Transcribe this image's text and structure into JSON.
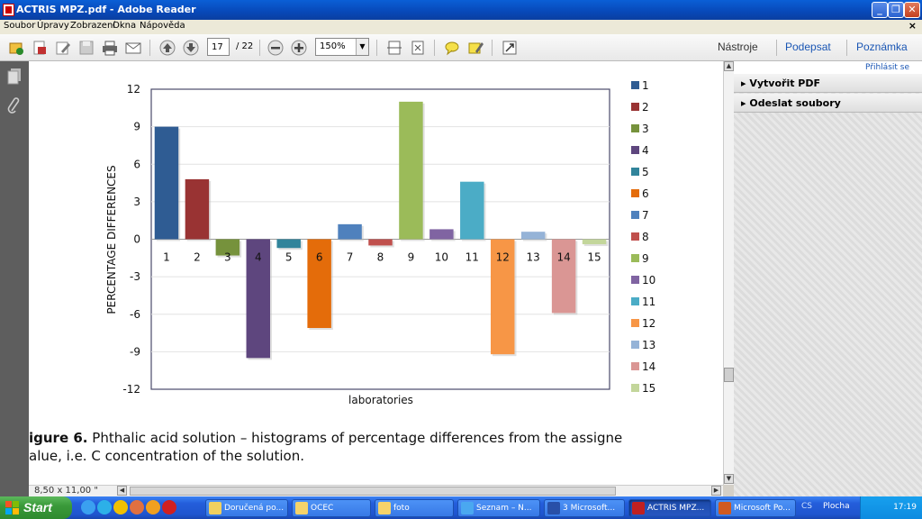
{
  "window": {
    "title": "ACTRIS MPZ.pdf - Adobe Reader"
  },
  "menu": [
    "Soubor",
    "Úpravy",
    "Zobrazení",
    "Okna",
    "Nápověda"
  ],
  "toolbar": {
    "page_current": "17",
    "page_total": "/ 22",
    "zoom": "150%",
    "links": [
      "Nástroje",
      "Podepsat",
      "Poznámka"
    ]
  },
  "right_pane": {
    "sign_in": "Přihlásit se",
    "items": [
      "Vytvořit PDF",
      "Odeslat soubory"
    ]
  },
  "document": {
    "caption_bold": "igure 6.",
    "caption_text": " Phthalic acid solution – histograms of percentage differences from the assigne",
    "caption_line2": "alue, i.e. C concentration of the solution."
  },
  "status": {
    "page_size": "8,50 x 11,00 \""
  },
  "chart_data": {
    "type": "bar",
    "categories": [
      "1",
      "2",
      "3",
      "4",
      "5",
      "6",
      "7",
      "8",
      "9",
      "10",
      "11",
      "12",
      "13",
      "14",
      "15"
    ],
    "values": [
      9.0,
      4.8,
      -1.3,
      -9.5,
      -0.7,
      -7.1,
      1.2,
      -0.5,
      11.0,
      0.8,
      4.6,
      -9.2,
      0.6,
      -5.9,
      -0.4
    ],
    "colors": [
      "#2f5c93",
      "#993333",
      "#76923c",
      "#5e467e",
      "#31849b",
      "#e46c0a",
      "#4f81bd",
      "#c0504d",
      "#9bbb59",
      "#8064a2",
      "#4bacc6",
      "#f79646",
      "#95b3d7",
      "#da9694",
      "#c3d69b"
    ],
    "legend": [
      "1",
      "2",
      "3",
      "4",
      "5",
      "6",
      "7",
      "8",
      "9",
      "10",
      "11",
      "12",
      "13",
      "14",
      "15"
    ],
    "ylabel": "PERCENTAGE DIFFERENCES",
    "xlabel": "laboratories",
    "yticks": [
      "12",
      "9",
      "6",
      "3",
      "0",
      "-3",
      "-6",
      "-9",
      "-12"
    ],
    "ylim": [
      -12,
      12
    ],
    "legend_position": "right"
  },
  "taskbar": {
    "start": "Start",
    "tasks": [
      "Doručená po...",
      "OCEC",
      "foto",
      "Seznam – N...",
      "3 Microsoft...",
      "ACTRIS MPZ...",
      "Microsoft Po..."
    ],
    "tray_label": "Plocha",
    "clock": "17:19",
    "cs": "CS"
  }
}
